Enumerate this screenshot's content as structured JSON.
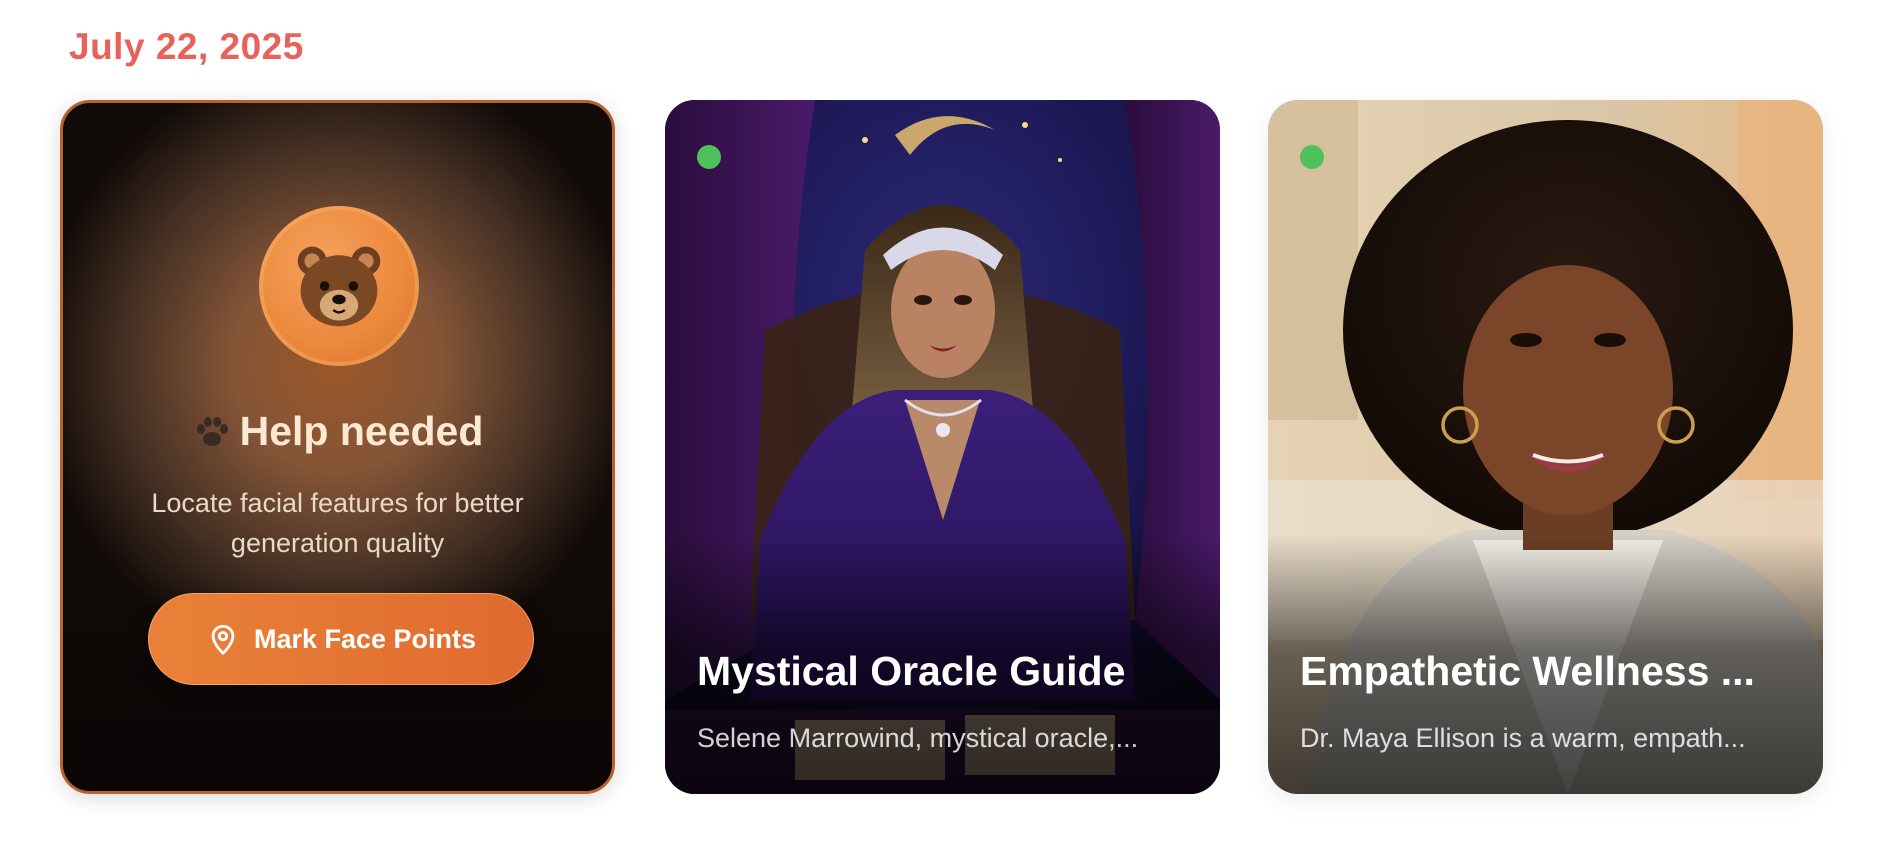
{
  "date_header": "July 22, 2025",
  "help_card": {
    "icon": "bear-face-icon",
    "title": "Help needed",
    "description": "Locate facial features for better generation quality",
    "button_label": "Mark Face Points",
    "accent_color": "#e8783a"
  },
  "characters": [
    {
      "name": "Mystical Oracle Guide",
      "description": "Selene Marrowind, mystical oracle,...",
      "online": true,
      "image": "portrait of a woman in a silver tiara and purple velvet gown seated on a throne"
    },
    {
      "name": "Empathetic Wellness ...",
      "description": "Dr. Maya Ellison is a warm, empath...",
      "online": true,
      "image": "portrait of a smiling woman with curly hair and gold hoop earrings"
    }
  ],
  "colors": {
    "date": "#e8625a",
    "online": "#4fc15a"
  }
}
